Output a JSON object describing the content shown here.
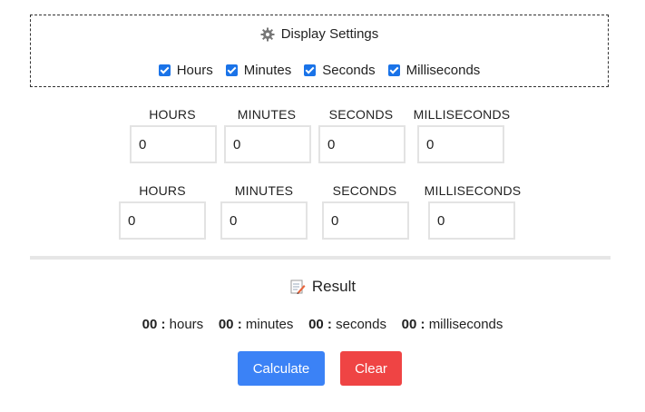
{
  "settings": {
    "title": "Display Settings",
    "options": [
      {
        "label": "Hours",
        "checked": true
      },
      {
        "label": "Minutes",
        "checked": true
      },
      {
        "label": "Seconds",
        "checked": true
      },
      {
        "label": "Milliseconds",
        "checked": true
      }
    ]
  },
  "time1": {
    "labels": [
      "HOURS",
      "MINUTES",
      "SECONDS",
      "MILLISECONDS"
    ],
    "values": [
      "0",
      "0",
      "0",
      "0"
    ]
  },
  "time2": {
    "labels": [
      "HOURS",
      "MINUTES",
      "SECONDS",
      "MILLISECONDS"
    ],
    "values": [
      "0",
      "0",
      "0",
      "0"
    ]
  },
  "result": {
    "title": "Result",
    "hours_value": "00 :",
    "hours_unit": "hours",
    "minutes_value": "00 :",
    "minutes_unit": "minutes",
    "seconds_value": "00 :",
    "seconds_unit": "seconds",
    "ms_value": "00 :",
    "ms_unit": "milliseconds"
  },
  "buttons": {
    "calculate": "Calculate",
    "clear": "Clear"
  },
  "colors": {
    "accent": "#3b82f6",
    "danger": "#ef4444",
    "checkbox": "#1a73e8"
  }
}
